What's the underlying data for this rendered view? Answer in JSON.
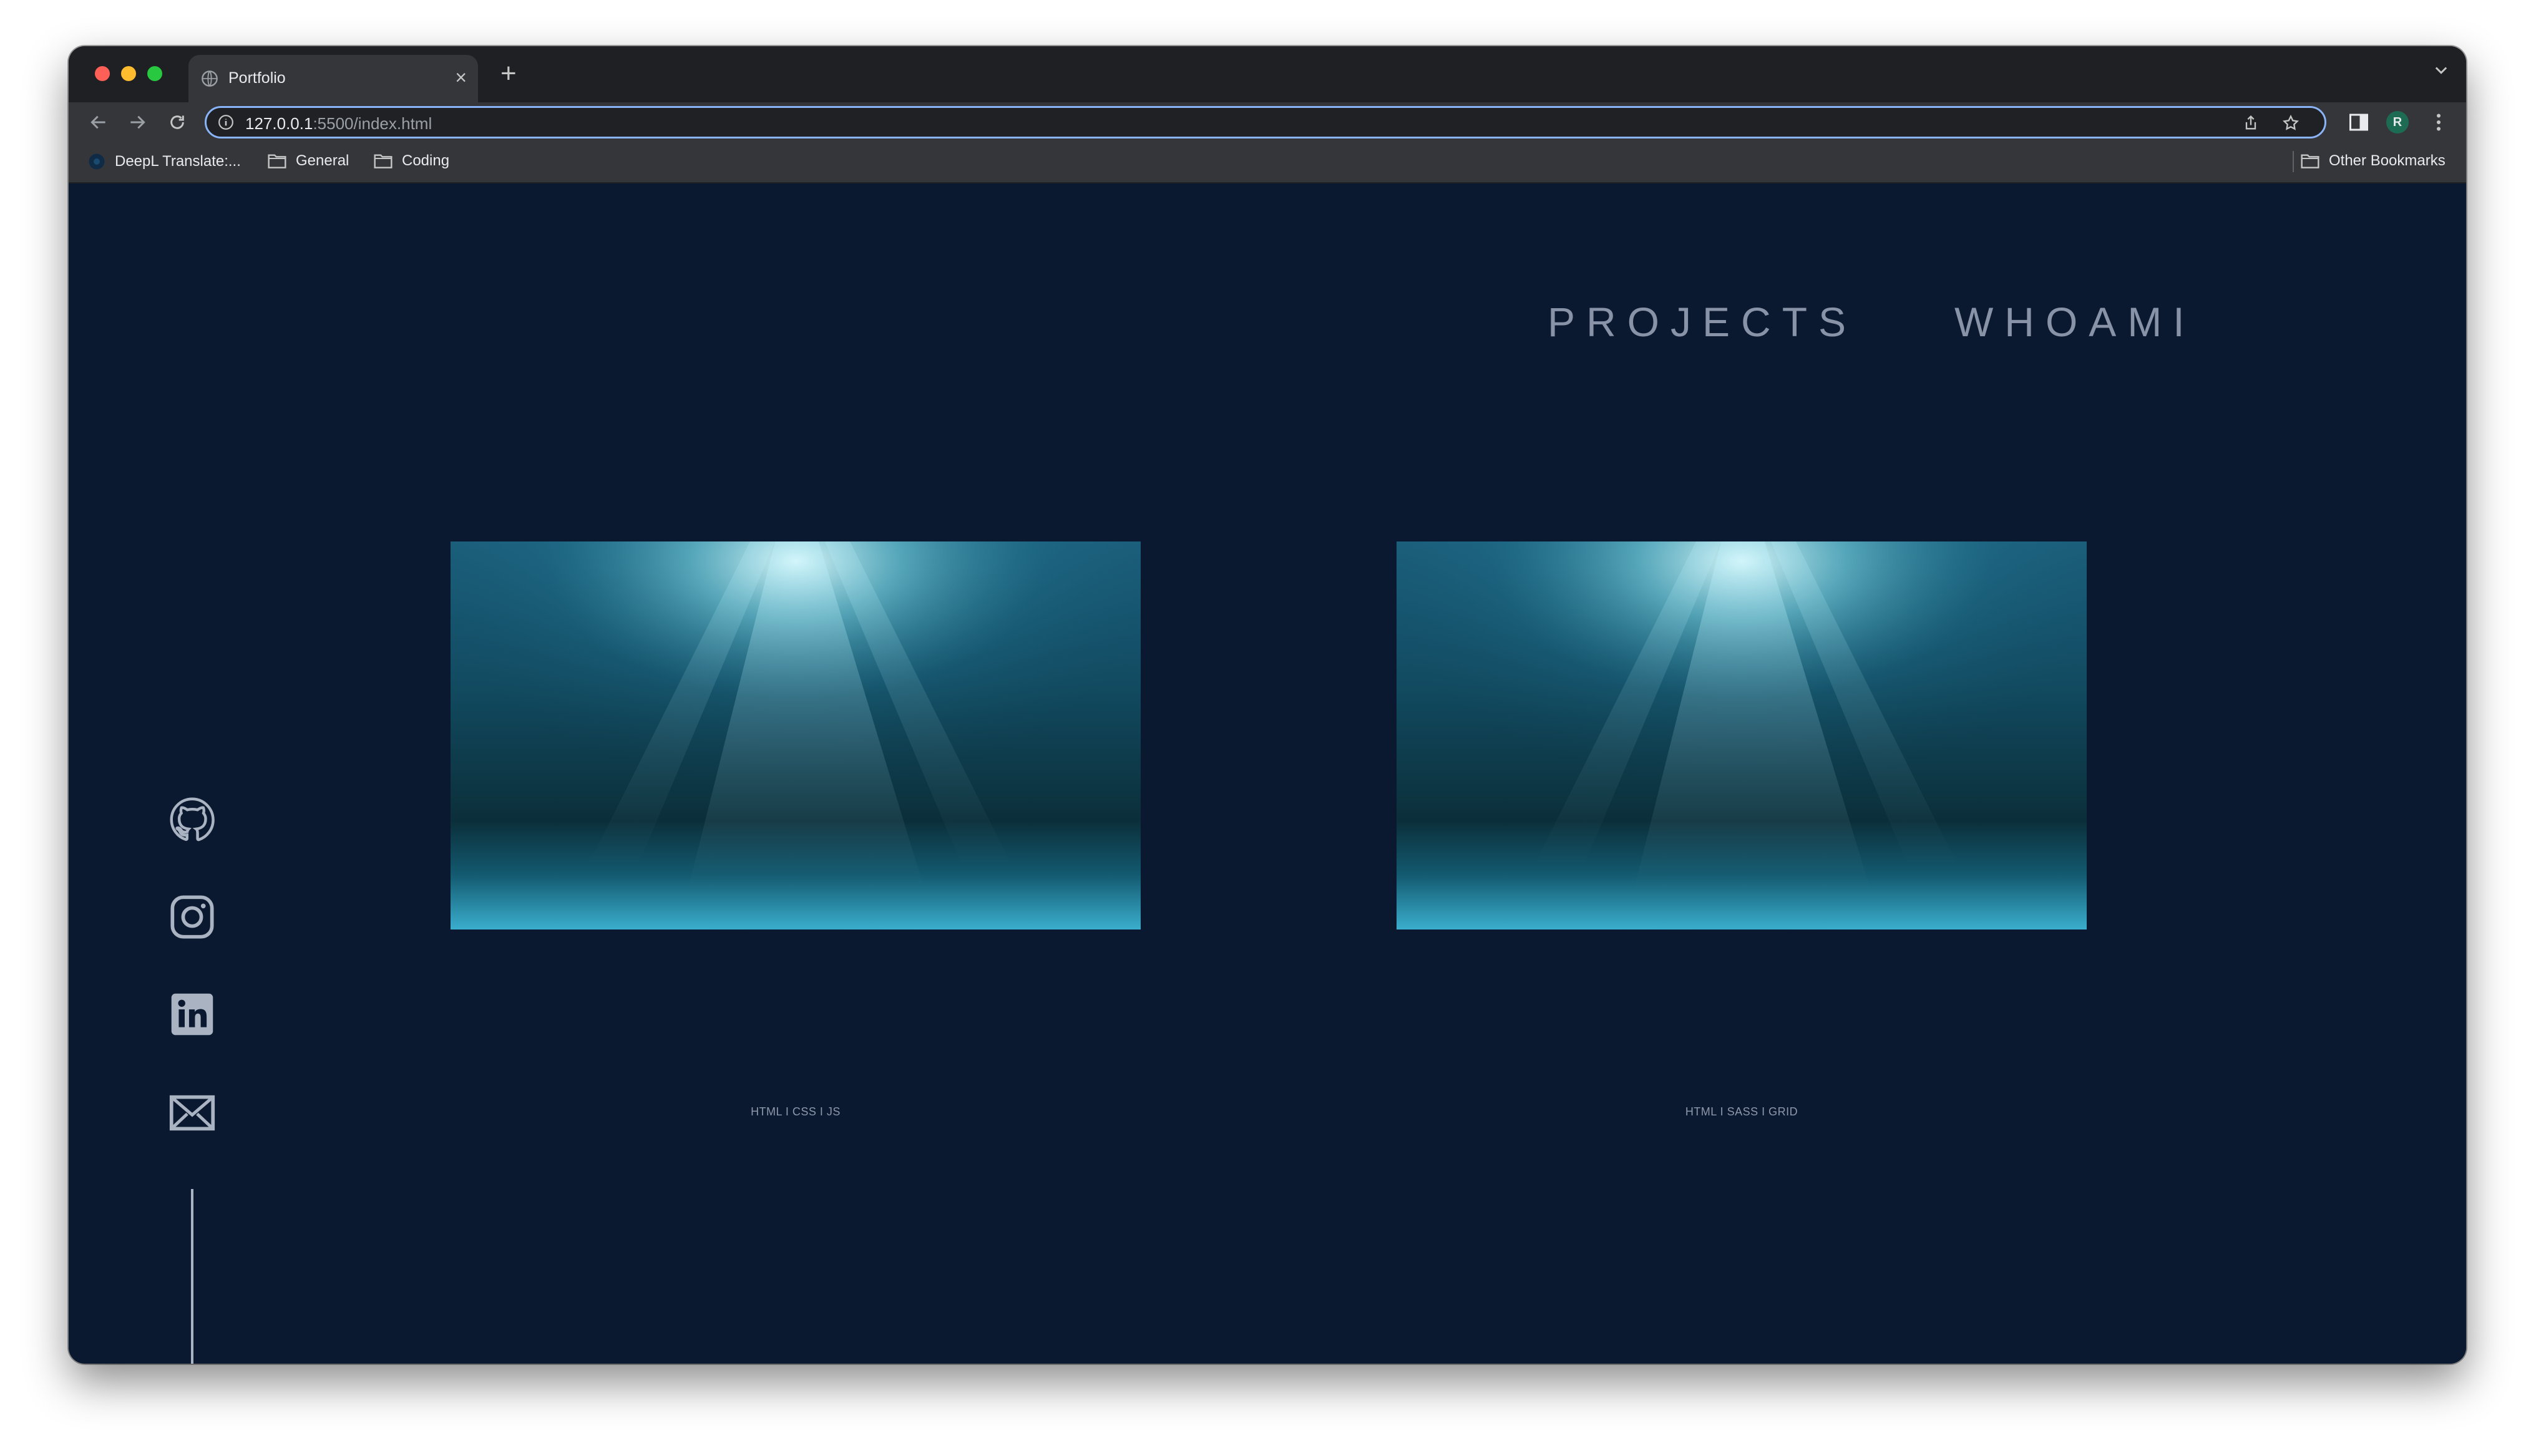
{
  "browser": {
    "tab_title": "Portfolio",
    "tab_close": "×",
    "new_tab": "+",
    "url_host": "127.0.0.1",
    "url_rest": ":5500/index.html",
    "profile_initial": "R",
    "bookmarks": [
      {
        "label": "DeepL Translate:...",
        "icon": "deepl-icon"
      },
      {
        "label": "General",
        "icon": "folder-icon"
      },
      {
        "label": "Coding",
        "icon": "folder-icon"
      }
    ],
    "other_bookmarks": "Other Bookmarks"
  },
  "nav": {
    "projects": "PROJECTS",
    "whoami": "WHOAMI"
  },
  "projects": [
    {
      "image": "underwater-image",
      "tags": "HTML I CSS I JS"
    },
    {
      "image": "underwater-image",
      "tags": "HTML I SASS I GRID"
    }
  ],
  "social": [
    {
      "icon": "github-icon"
    },
    {
      "icon": "instagram-icon"
    },
    {
      "icon": "linkedin-icon"
    },
    {
      "icon": "mail-icon"
    }
  ],
  "colors": {
    "page_background": "#0b1930",
    "nav_text": "#8893a8",
    "icon_color": "#aab3c2",
    "omnibox_focus": "#8ab4f8"
  }
}
